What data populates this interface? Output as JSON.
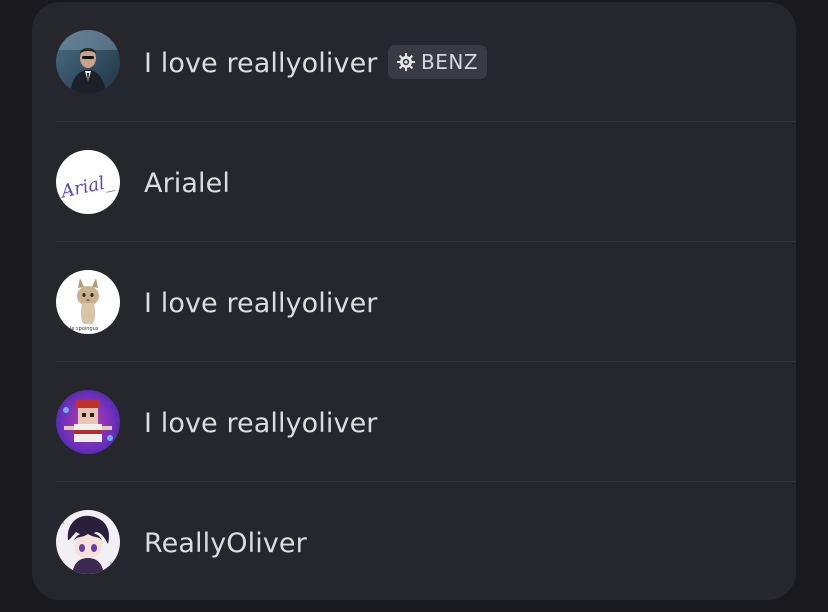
{
  "members": [
    {
      "name": "I love reallyoliver",
      "avatar": "suited-man-avatar",
      "tag": {
        "icon": "gear-icon",
        "label": "BENZ"
      }
    },
    {
      "name": "Arialel",
      "avatar": "handwritten-arial-avatar",
      "avatar_text": "Arial_"
    },
    {
      "name": "I love reallyoliver",
      "avatar": "cat-meme-avatar",
      "avatar_text": "le spoingus"
    },
    {
      "name": "I love reallyoliver",
      "avatar": "pixel-character-avatar"
    },
    {
      "name": "ReallyOliver",
      "avatar": "anime-character-avatar"
    }
  ]
}
